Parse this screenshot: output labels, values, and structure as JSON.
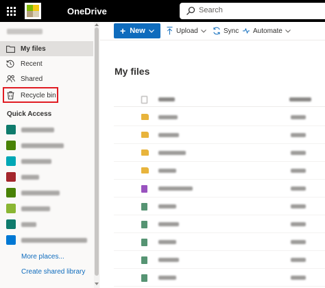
{
  "app": {
    "title": "OneDrive",
    "search_placeholder": "Search",
    "brand_color": "#0f6cbd"
  },
  "sidebar": {
    "user_name": "",
    "nav": [
      {
        "label": "My files",
        "icon": "folder-icon",
        "selected": true
      },
      {
        "label": "Recent",
        "icon": "recent-clock-icon",
        "selected": false
      },
      {
        "label": "Shared",
        "icon": "shared-people-icon",
        "selected": false
      },
      {
        "label": "Recycle bin",
        "icon": "recycle-bin-icon",
        "selected": false,
        "highlight_color": "#e01b22"
      }
    ],
    "quick_access_title": "Quick Access",
    "quick_access": [
      {
        "icon": "site-icon",
        "color": "#0f7b6c"
      },
      {
        "icon": "site-icon",
        "color": "#498205"
      },
      {
        "icon": "site-icon",
        "color": "#00a7b5"
      },
      {
        "icon": "site-icon",
        "color": "#a4262c"
      },
      {
        "icon": "site-icon",
        "color": "#498205"
      },
      {
        "icon": "site-icon",
        "color": "#8ab633"
      },
      {
        "icon": "site-icon",
        "color": "#0f7b6c"
      },
      {
        "icon": "site-icon",
        "color": "#0078d4"
      }
    ],
    "more_places": "More places...",
    "create_library": "Create shared library"
  },
  "commands": {
    "new": "New",
    "upload": "Upload",
    "sync": "Sync",
    "automate": "Automate"
  },
  "main": {
    "title": "My files",
    "files": [
      {
        "icon": "folder-icon",
        "color": "#e8b43c"
      },
      {
        "icon": "folder-icon",
        "color": "#e8b43c"
      },
      {
        "icon": "folder-icon",
        "color": "#e8b43c"
      },
      {
        "icon": "folder-icon",
        "color": "#e8b43c"
      },
      {
        "icon": "onenote-icon",
        "color": "#7719aa"
      },
      {
        "icon": "excel-file-icon",
        "color": "#1d7044"
      },
      {
        "icon": "excel-file-icon",
        "color": "#1d7044"
      },
      {
        "icon": "excel-file-icon",
        "color": "#1d7044"
      },
      {
        "icon": "excel-file-icon",
        "color": "#1d7044"
      },
      {
        "icon": "excel-file-icon",
        "color": "#1d7044"
      }
    ]
  }
}
